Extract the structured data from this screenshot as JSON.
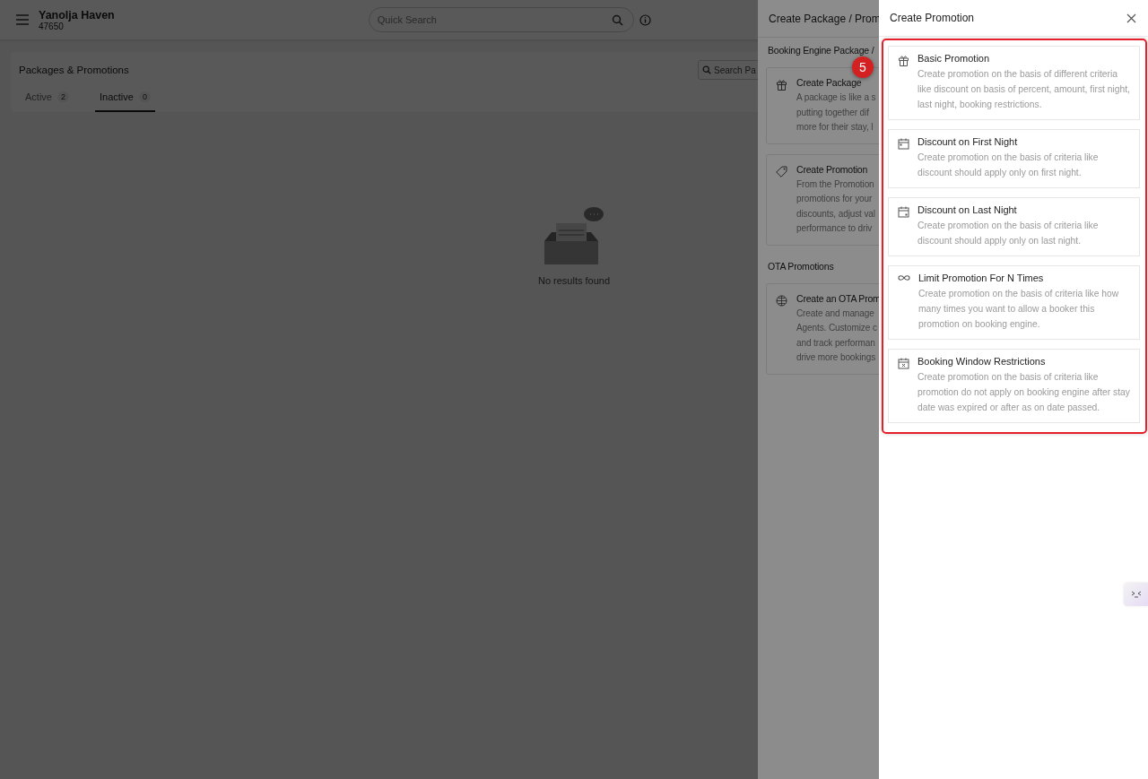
{
  "app_header": {
    "property_name": "Yanolja Haven",
    "property_code": "47650",
    "search": {
      "placeholder": "Quick Search"
    }
  },
  "page": {
    "title": "Packages & Promotions",
    "search": {
      "placeholder": "Search Pa"
    },
    "tabs": [
      {
        "label": "Active",
        "count": "2",
        "selected": false
      },
      {
        "label": "Inactive",
        "count": "0",
        "selected": true
      }
    ],
    "empty_state": {
      "message": "No results found"
    }
  },
  "package_drawer": {
    "title": "Create Package / Prom",
    "sections": [
      {
        "heading": "Booking Engine Package /",
        "options": [
          {
            "kind": "gift",
            "title": "Create Package",
            "lines": [
              "A package is like a s",
              "putting together dif",
              "more for their stay, l"
            ]
          },
          {
            "kind": "tag",
            "title": "Create Promotion",
            "lines": [
              "From the Promotion",
              "promotions for your",
              "discounts, adjust val",
              "performance to driv"
            ]
          }
        ]
      },
      {
        "heading": "OTA Promotions",
        "options": [
          {
            "kind": "globe",
            "title": "Create an OTA Prom",
            "lines": [
              "Create and manage",
              "Agents. Customize c",
              "and track performan",
              "drive more bookings"
            ]
          }
        ]
      }
    ]
  },
  "promotion_drawer": {
    "title": "Create Promotion",
    "options": [
      {
        "kind": "gift",
        "title": "Basic Promotion",
        "description": "Create promotion on the basis of different criteria like discount on basis of percent, amount, first night, last night, booking restrictions."
      },
      {
        "kind": "calendar-first",
        "title": "Discount on First Night",
        "description": "Create promotion on the basis of criteria like discount should apply only on first night."
      },
      {
        "kind": "calendar-last",
        "title": "Discount on Last Night",
        "description": "Create promotion on the basis of criteria like discount should apply only on last night."
      },
      {
        "kind": "infinity",
        "title": "Limit Promotion For N Times",
        "description": "Create promotion on the basis of criteria like how many times you want to allow a booker this promotion on booking engine."
      },
      {
        "kind": "calendar-x",
        "title": "Booking Window Restrictions",
        "description": "Create promotion on the basis of criteria like promotion do not apply on booking engine after stay date was expired or after as on date passed."
      }
    ]
  },
  "step_badge": "5"
}
